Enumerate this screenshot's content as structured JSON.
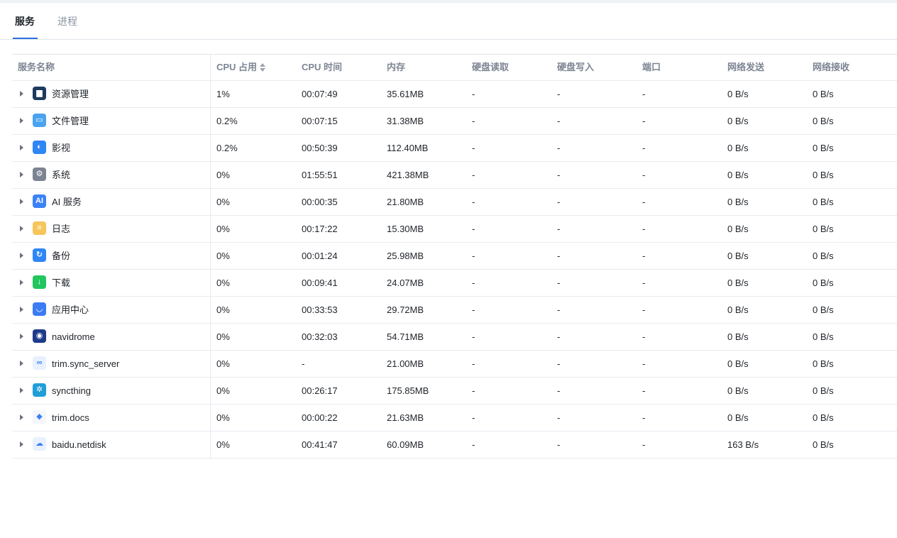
{
  "tabs": [
    {
      "label": "服务",
      "active": true
    },
    {
      "label": "进程",
      "active": false
    }
  ],
  "columns": [
    "服务名称",
    "CPU 占用",
    "CPU 时间",
    "内存",
    "硬盘读取",
    "硬盘写入",
    "端口",
    "网络发送",
    "网络接收"
  ],
  "rows": [
    {
      "name": "资源管理",
      "icon": "resource-monitor-icon",
      "color": "#1e3a5f",
      "glyph": "▆",
      "cpu": "1%",
      "cpu_time": "00:07:49",
      "memory": "35.61MB",
      "disk_read": "-",
      "disk_write": "-",
      "port": "-",
      "net_send": "0 B/s",
      "net_recv": "0 B/s"
    },
    {
      "name": "文件管理",
      "icon": "folder-icon",
      "color": "#4aa3f0",
      "glyph": "▭",
      "cpu": "0.2%",
      "cpu_time": "00:07:15",
      "memory": "31.38MB",
      "disk_read": "-",
      "disk_write": "-",
      "port": "-",
      "net_send": "0 B/s",
      "net_recv": "0 B/s"
    },
    {
      "name": "影视",
      "icon": "video-icon",
      "color": "#2f86f6",
      "glyph": "◐",
      "cpu": "0.2%",
      "cpu_time": "00:50:39",
      "memory": "112.40MB",
      "disk_read": "-",
      "disk_write": "-",
      "port": "-",
      "net_send": "0 B/s",
      "net_recv": "0 B/s"
    },
    {
      "name": "系统",
      "icon": "gear-icon",
      "color": "#7c8493",
      "glyph": "⚙",
      "cpu": "0%",
      "cpu_time": "01:55:51",
      "memory": "421.38MB",
      "disk_read": "-",
      "disk_write": "-",
      "port": "-",
      "net_send": "0 B/s",
      "net_recv": "0 B/s"
    },
    {
      "name": "AI 服务",
      "icon": "ai-icon",
      "color": "#3b82f6",
      "glyph": "AI",
      "cpu": "0%",
      "cpu_time": "00:00:35",
      "memory": "21.80MB",
      "disk_read": "-",
      "disk_write": "-",
      "port": "-",
      "net_send": "0 B/s",
      "net_recv": "0 B/s"
    },
    {
      "name": "日志",
      "icon": "log-icon",
      "color": "#f6c55b",
      "glyph": "≡",
      "cpu": "0%",
      "cpu_time": "00:17:22",
      "memory": "15.30MB",
      "disk_read": "-",
      "disk_write": "-",
      "port": "-",
      "net_send": "0 B/s",
      "net_recv": "0 B/s"
    },
    {
      "name": "备份",
      "icon": "backup-icon",
      "color": "#2f86f6",
      "glyph": "↻",
      "cpu": "0%",
      "cpu_time": "00:01:24",
      "memory": "25.98MB",
      "disk_read": "-",
      "disk_write": "-",
      "port": "-",
      "net_send": "0 B/s",
      "net_recv": "0 B/s"
    },
    {
      "name": "下载",
      "icon": "download-icon",
      "color": "#22c55e",
      "glyph": "↓",
      "cpu": "0%",
      "cpu_time": "00:09:41",
      "memory": "24.07MB",
      "disk_read": "-",
      "disk_write": "-",
      "port": "-",
      "net_send": "0 B/s",
      "net_recv": "0 B/s"
    },
    {
      "name": "应用中心",
      "icon": "app-center-icon",
      "color": "#3b7cf5",
      "glyph": "◡",
      "cpu": "0%",
      "cpu_time": "00:33:53",
      "memory": "29.72MB",
      "disk_read": "-",
      "disk_write": "-",
      "port": "-",
      "net_send": "0 B/s",
      "net_recv": "0 B/s"
    },
    {
      "name": "navidrome",
      "icon": "navidrome-icon",
      "color": "#1e3a8a",
      "glyph": "◉",
      "cpu": "0%",
      "cpu_time": "00:32:03",
      "memory": "54.71MB",
      "disk_read": "-",
      "disk_write": "-",
      "port": "-",
      "net_send": "0 B/s",
      "net_recv": "0 B/s"
    },
    {
      "name": "trim.sync_server",
      "icon": "sync-server-icon",
      "color": "#e9f1fe",
      "glyph": "∞",
      "cpu": "0%",
      "cpu_time": "-",
      "memory": "21.00MB",
      "disk_read": "-",
      "disk_write": "-",
      "port": "-",
      "net_send": "0 B/s",
      "net_recv": "0 B/s"
    },
    {
      "name": "syncthing",
      "icon": "syncthing-icon",
      "color": "#1f9ed8",
      "glyph": "✲",
      "cpu": "0%",
      "cpu_time": "00:26:17",
      "memory": "175.85MB",
      "disk_read": "-",
      "disk_write": "-",
      "port": "-",
      "net_send": "0 B/s",
      "net_recv": "0 B/s"
    },
    {
      "name": "trim.docs",
      "icon": "docs-icon",
      "color": "#f4f6fa",
      "glyph": "◆",
      "cpu": "0%",
      "cpu_time": "00:00:22",
      "memory": "21.63MB",
      "disk_read": "-",
      "disk_write": "-",
      "port": "-",
      "net_send": "0 B/s",
      "net_recv": "0 B/s"
    },
    {
      "name": "baidu.netdisk",
      "icon": "netdisk-icon",
      "color": "#e9f1fe",
      "glyph": "☁",
      "cpu": "0%",
      "cpu_time": "00:41:47",
      "memory": "60.09MB",
      "disk_read": "-",
      "disk_write": "-",
      "port": "-",
      "net_send": "163 B/s",
      "net_recv": "0 B/s"
    }
  ]
}
